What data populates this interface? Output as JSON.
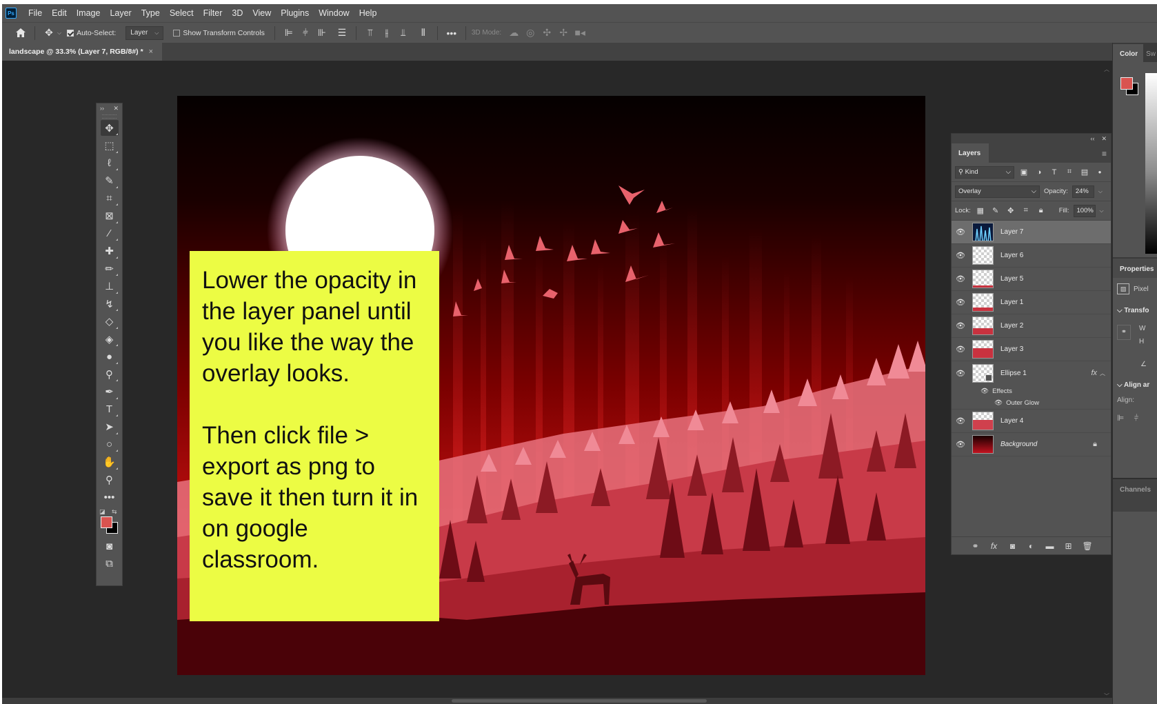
{
  "app": {
    "logo_text": "Ps"
  },
  "menu": [
    "File",
    "Edit",
    "Image",
    "Layer",
    "Type",
    "Select",
    "Filter",
    "3D",
    "View",
    "Plugins",
    "Window",
    "Help"
  ],
  "options_bar": {
    "auto_select_label": "Auto-Select:",
    "auto_select_target": "Layer",
    "show_transform_label": "Show Transform Controls",
    "mode_3d_label": "3D Mode:"
  },
  "document_tab": {
    "title": "landscape @ 33.3% (Layer 7, RGB/8#) *",
    "close": "×"
  },
  "instruction_note": {
    "paragraph_1": "Lower the opacity in the layer panel until you like the way the overlay looks.",
    "paragraph_2": "Then click file > export as png to save it then turn it in on google classroom."
  },
  "layers_panel": {
    "tab": "Layers",
    "filter_kind": "Kind",
    "blend_mode": "Overlay",
    "opacity_label": "Opacity:",
    "opacity_value": "24%",
    "lock_label": "Lock:",
    "fill_label": "Fill:",
    "fill_value": "100%",
    "layers": [
      {
        "name": "Layer 7",
        "selected": true,
        "thumb": "image"
      },
      {
        "name": "Layer 6",
        "selected": false,
        "thumb": "transparent"
      },
      {
        "name": "Layer 5",
        "selected": false,
        "thumb": "transparent"
      },
      {
        "name": "Layer 1",
        "selected": false,
        "thumb": "transparent"
      },
      {
        "name": "Layer 2",
        "selected": false,
        "thumb": "red-low"
      },
      {
        "name": "Layer 3",
        "selected": false,
        "thumb": "red-mid"
      },
      {
        "name": "Ellipse 1",
        "selected": false,
        "thumb": "shape",
        "fx": "fx"
      },
      {
        "name": "Layer 4",
        "selected": false,
        "thumb": "red-mid"
      },
      {
        "name": "Background",
        "selected": false,
        "thumb": "red-full",
        "locked": true
      }
    ],
    "effects_label": "Effects",
    "effect_item": "Outer Glow"
  },
  "right_dock": {
    "color_tab": "Color",
    "swatches_tab": "Sw",
    "properties_title": "Properties",
    "pixel_label": "Pixel",
    "transform_label": "Transfo",
    "w_label": "W",
    "h_label": "H",
    "align_label": "Align ar",
    "align_sub": "Align:",
    "channels_tab": "Channels"
  },
  "colors": {
    "foreground": "#d9534f",
    "background": "#000000",
    "note_yellow": "#ecfc44",
    "ui_panel": "#535353",
    "workspace": "#282828"
  }
}
